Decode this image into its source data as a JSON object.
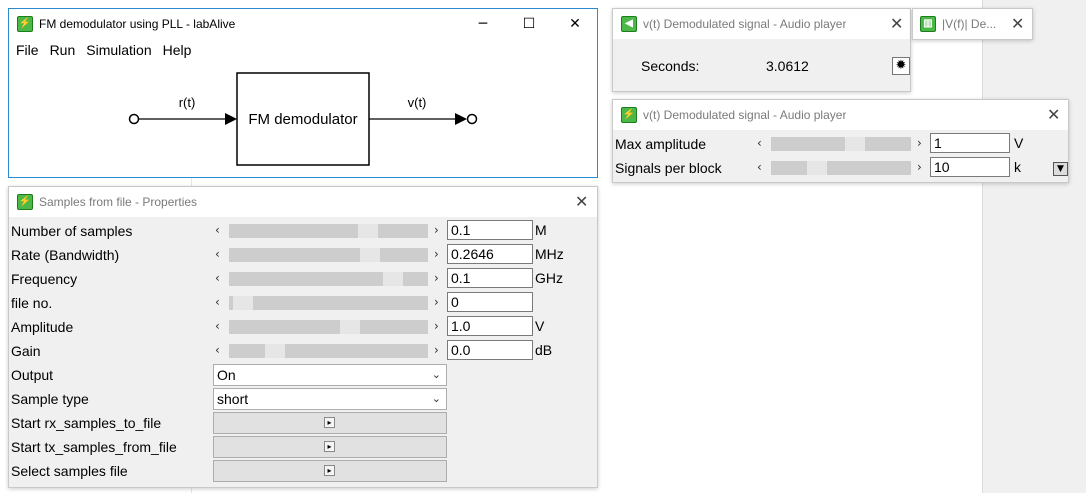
{
  "main_window": {
    "title": "FM demodulator using PLL - labAlive",
    "menu": [
      "File",
      "Run",
      "Simulation",
      "Help"
    ],
    "diagram": {
      "block_label": "FM demodulator",
      "input_label": "r(t)",
      "output_label": "v(t)"
    },
    "controls": {
      "minimize": "─",
      "maximize": "☐",
      "close": "✕"
    }
  },
  "audio_player_seconds": {
    "title": "v(t) Demodulated signal - Audio player",
    "label": "Seconds:",
    "value": "3.0612",
    "close": "✕"
  },
  "spectrum_tab": {
    "title": "|V(f)| De...",
    "close": "✕"
  },
  "audio_player_props": {
    "title": "v(t) Demodulated signal - Audio player",
    "close": "✕",
    "rows": [
      {
        "label": "Max amplitude",
        "value": "1",
        "unit": "V",
        "slider_fraction": 0.62
      },
      {
        "label": "Signals per block",
        "value": "10",
        "unit": "k",
        "slider_fraction": 0.3
      }
    ]
  },
  "samples_props": {
    "title": "Samples from file - Properties",
    "close": "✕",
    "rows": [
      {
        "label": "Number of samples",
        "value": "0.1",
        "unit": "M",
        "slider_fraction": 0.72
      },
      {
        "label": "Rate (Bandwidth)",
        "value": "0.2646",
        "unit": "MHz",
        "slider_fraction": 0.73
      },
      {
        "label": "Frequency",
        "value": "0.1",
        "unit": "GHz",
        "slider_fraction": 0.86
      },
      {
        "label": "file no.",
        "value": "0",
        "unit": "",
        "slider_fraction": 0.02
      },
      {
        "label": "Amplitude",
        "value": "1.0",
        "unit": "V",
        "slider_fraction": 0.62
      },
      {
        "label": "Gain",
        "value": "0.0",
        "unit": "dB",
        "slider_fraction": 0.2
      }
    ],
    "selects": [
      {
        "label": "Output",
        "value": "On"
      },
      {
        "label": "Sample type",
        "value": "short"
      }
    ],
    "actions": [
      {
        "label": "Start rx_samples_to_file"
      },
      {
        "label": "Start tx_samples_from_file"
      },
      {
        "label": "Select samples file"
      }
    ]
  },
  "colors": {
    "app_icon": "#4cb848",
    "main_border": "#2a8bd0",
    "slider_track": "#cdcdcd"
  }
}
